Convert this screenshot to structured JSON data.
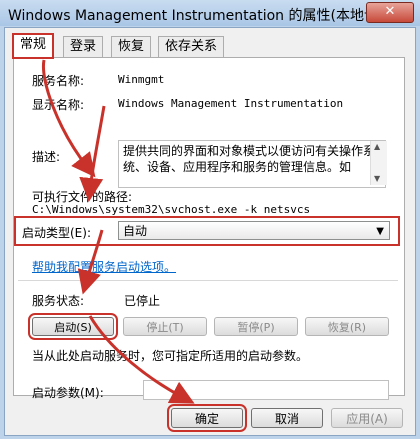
{
  "window": {
    "title": "Windows Management Instrumentation 的属性(本地计算机)",
    "close_glyph": "✕"
  },
  "tabs": [
    {
      "label": "常规",
      "active": true
    },
    {
      "label": "登录",
      "active": false
    },
    {
      "label": "恢复",
      "active": false
    },
    {
      "label": "依存关系",
      "active": false
    }
  ],
  "general": {
    "service_name_label": "服务名称:",
    "service_name_value": "Winmgmt",
    "display_name_label": "显示名称:",
    "display_name_value": "Windows Management Instrumentation",
    "description_label": "描述:",
    "description_value": "提供共同的界面和对象模式以便访问有关操作系统、设备、应用程序和服务的管理信息。如",
    "exe_path_label": "可执行文件的路径:",
    "exe_path_value": "C:\\Windows\\system32\\svchost.exe -k netsvcs",
    "startup_type_label": "启动类型(E):",
    "startup_type_value": "自动",
    "help_link": "帮助我配置服务启动选项。",
    "status_label": "服务状态:",
    "status_value": "已停止",
    "start_button": "启动(S)",
    "stop_button": "停止(T)",
    "pause_button": "暂停(P)",
    "resume_button": "恢复(R)",
    "hint_text": "当从此处启动服务时，您可指定所适用的启动参数。",
    "start_params_label": "启动参数(M):",
    "start_params_value": ""
  },
  "footer": {
    "ok_button": "确定",
    "cancel_button": "取消",
    "apply_button": "应用(A)"
  },
  "colors": {
    "annotation_red": "#c8322a",
    "link_blue": "#0066cc"
  }
}
